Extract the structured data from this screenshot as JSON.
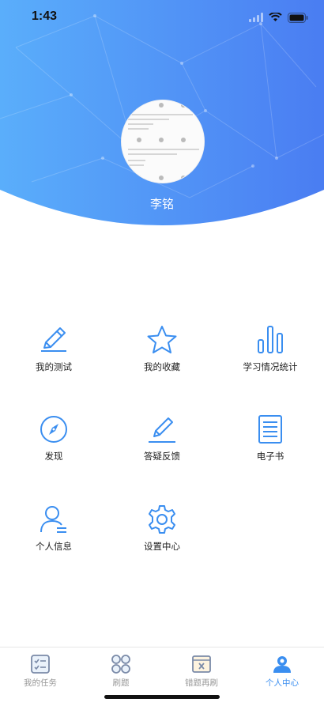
{
  "status_bar": {
    "time": "1:43"
  },
  "profile": {
    "username": "李铭"
  },
  "menu": {
    "items": [
      {
        "label": "我的测试",
        "icon": "pencil-icon"
      },
      {
        "label": "我的收藏",
        "icon": "star-icon"
      },
      {
        "label": "学习情况统计",
        "icon": "bar-chart-icon"
      },
      {
        "label": "发现",
        "icon": "compass-icon"
      },
      {
        "label": "答疑反馈",
        "icon": "feedback-pen-icon"
      },
      {
        "label": "电子书",
        "icon": "ebook-icon"
      },
      {
        "label": "个人信息",
        "icon": "person-icon"
      },
      {
        "label": "设置中心",
        "icon": "gear-icon"
      }
    ]
  },
  "tabbar": {
    "tabs": [
      {
        "label": "我的任务",
        "icon": "task-list-icon"
      },
      {
        "label": "刷题",
        "icon": "grid-dots-icon"
      },
      {
        "label": "错题再刷",
        "icon": "wrong-questions-icon"
      },
      {
        "label": "个人中心",
        "icon": "user-center-icon"
      }
    ],
    "active": "个人中心"
  },
  "colors": {
    "accent": "#3a8ef0",
    "header_start": "#55a8f8",
    "header_end": "#4a7cf0"
  }
}
